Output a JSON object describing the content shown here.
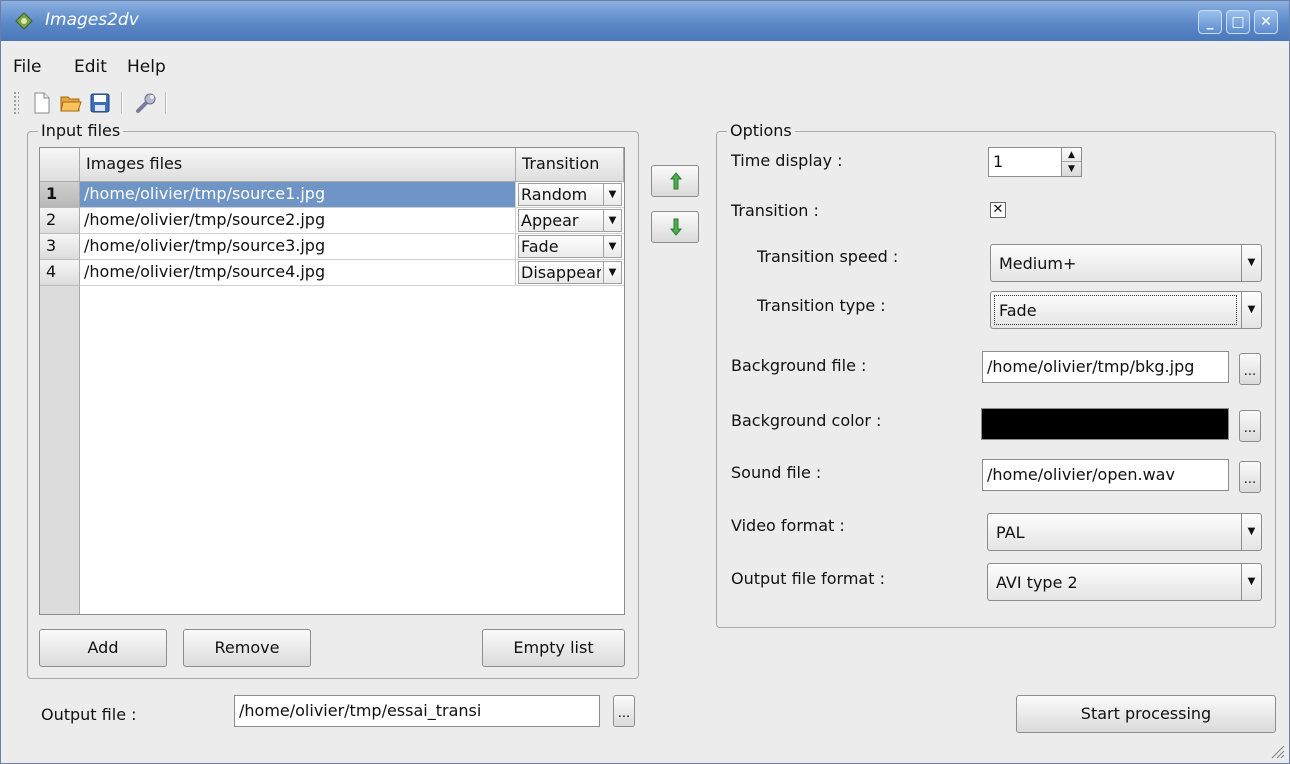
{
  "window": {
    "title": "Images2dv"
  },
  "menu": {
    "file": "File",
    "edit": "Edit",
    "help": "Help"
  },
  "toolbar": {
    "new": "new-file-icon",
    "open": "open-folder-icon",
    "save": "save-disk-icon",
    "settings": "wrench-icon"
  },
  "input_files": {
    "title": "Input files",
    "columns": [
      "Images files",
      "Transition"
    ],
    "rows": [
      {
        "num": "1",
        "file": "/home/olivier/tmp/source1.jpg",
        "transition": "Random",
        "selected": true
      },
      {
        "num": "2",
        "file": "/home/olivier/tmp/source2.jpg",
        "transition": "Appear",
        "selected": false
      },
      {
        "num": "3",
        "file": "/home/olivier/tmp/source3.jpg",
        "transition": "Fade",
        "selected": false
      },
      {
        "num": "4",
        "file": "/home/olivier/tmp/source4.jpg",
        "transition": "Disappear",
        "selected": false
      }
    ],
    "add_label": "Add",
    "remove_label": "Remove",
    "empty_label": "Empty list"
  },
  "move": {
    "up_icon": "arrow-up-icon",
    "down_icon": "arrow-down-icon",
    "arrow_color": "#3c9a3c"
  },
  "output": {
    "label": "Output file :",
    "value": "/home/olivier/tmp/essai_transi",
    "browse": "..."
  },
  "options": {
    "title": "Options",
    "time_display_label": "Time display :",
    "time_display_value": "1",
    "transition_label": "Transition :",
    "transition_checked": true,
    "transition_speed_label": "Transition speed :",
    "transition_speed_value": "Medium+",
    "transition_type_label": "Transition type :",
    "transition_type_value": "Fade",
    "background_file_label": "Background file :",
    "background_file_value": "/home/olivier/tmp/bkg.jpg",
    "background_color_label": "Background color :",
    "background_color_value": "#000000",
    "sound_file_label": "Sound file :",
    "sound_file_value": "/home/olivier/open.wav",
    "video_format_label": "Video format :",
    "video_format_value": "PAL",
    "output_format_label": "Output file format :",
    "output_format_value": "AVI type 2",
    "browse": "..."
  },
  "start_label": "Start processing",
  "colors": {
    "titlebar": "#5b89c8",
    "selection": "#6f95c7"
  }
}
